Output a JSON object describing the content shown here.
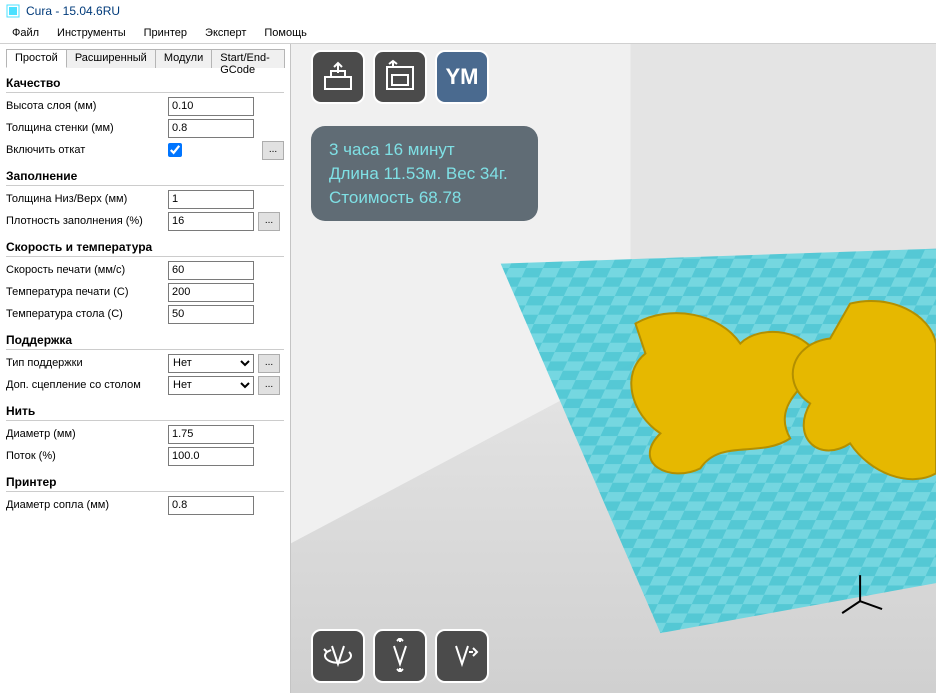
{
  "window": {
    "title": "Cura - 15.04.6RU"
  },
  "menu": {
    "file": "Файл",
    "tools": "Инструменты",
    "printer": "Принтер",
    "expert": "Эксперт",
    "help": "Помощь"
  },
  "tabs": {
    "simple": "Простой",
    "advanced": "Расширенный",
    "plugins": "Модули",
    "startend": "Start/End-GCode"
  },
  "sections": {
    "quality": {
      "title": "Качество",
      "layer_height_label": "Высота слоя (мм)",
      "layer_height_value": "0.10",
      "wall_thickness_label": "Толщина стенки (мм)",
      "wall_thickness_value": "0.8",
      "retraction_label": "Включить откат",
      "retraction_value": true
    },
    "fill": {
      "title": "Заполнение",
      "topbottom_label": "Толщина Низ/Верх (мм)",
      "topbottom_value": "1",
      "density_label": "Плотность заполнения (%)",
      "density_value": "16"
    },
    "speedtemp": {
      "title": "Скорость и температура",
      "speed_label": "Скорость печати (мм/с)",
      "speed_value": "60",
      "printtemp_label": "Температура печати (C)",
      "printtemp_value": "200",
      "bedtemp_label": "Температура стола (C)",
      "bedtemp_value": "50"
    },
    "support": {
      "title": "Поддержка",
      "type_label": "Тип поддержки",
      "type_value": "Нет",
      "adhesion_label": "Доп. сцепление со столом",
      "adhesion_value": "Нет"
    },
    "filament": {
      "title": "Нить",
      "diameter_label": "Диаметр (мм)",
      "diameter_value": "1.75",
      "flow_label": "Поток (%)",
      "flow_value": "100.0"
    },
    "machine": {
      "title": "Принтер",
      "nozzle_label": "Диаметр сопла (мм)",
      "nozzle_value": "0.8"
    }
  },
  "ellipsis": "...",
  "overlay": {
    "time": "3 часа 16 минут",
    "length_weight": "Длина 11.53м. Вес 34г.",
    "cost": "Стоимость 68.78"
  },
  "tool_ym": "YM"
}
